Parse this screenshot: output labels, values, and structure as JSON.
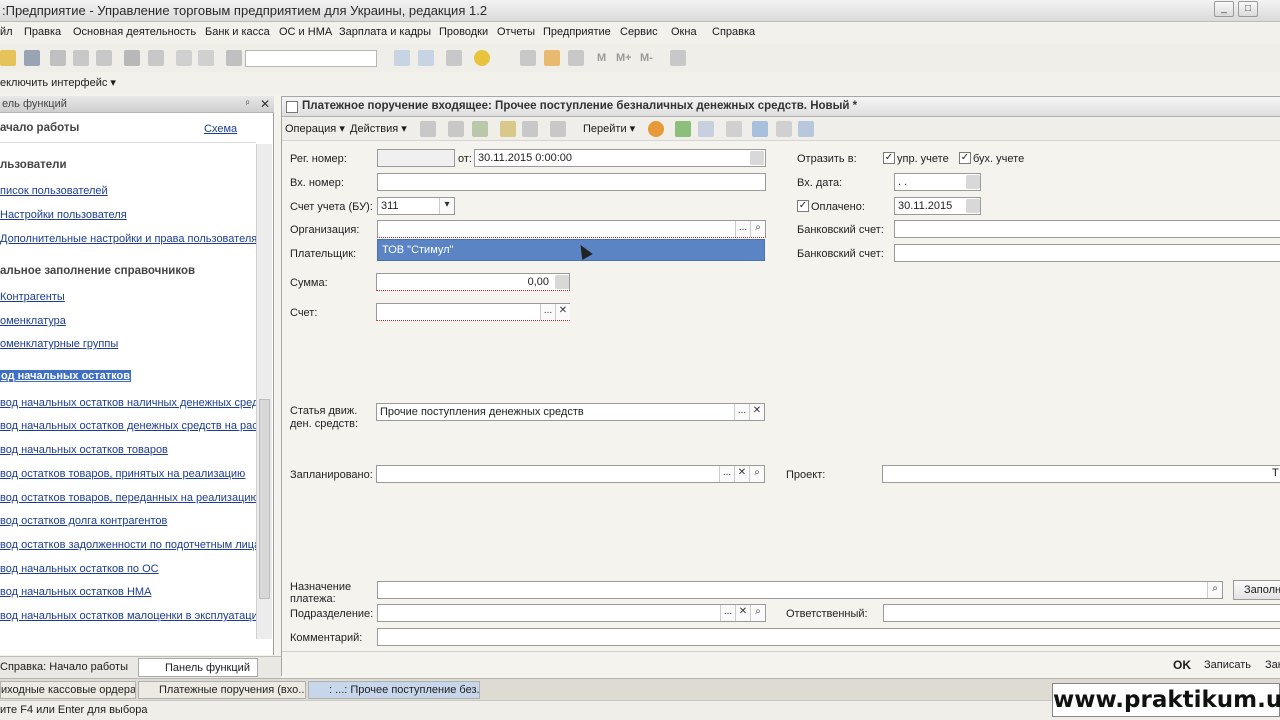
{
  "window": {
    "title": ":Предприятие - Управление торговым предприятием для Украины, редакция 1.2",
    "min": "_",
    "max": "□"
  },
  "menu": [
    "йл",
    "Правка",
    "Основная деятельность",
    "Банк и касса",
    "ОС и НМА",
    "Зарплата и кадры",
    "Проводки",
    "Отчеты",
    "Предприятие",
    "Сервис",
    "Окна",
    "Справка"
  ],
  "toolbar": {
    "m": "M",
    "mplus": "M+",
    "mminus": "M-"
  },
  "switch": {
    "label": "еключить интерфейс ▾"
  },
  "left_panel": {
    "header": "ель функций",
    "pin": "ᵖ",
    "close": "✕",
    "start": "ачало работы",
    "scheme": "Схема",
    "sec_users": "льзователи",
    "users": [
      "писок пользователей",
      "Настройки пользователя",
      "Дополнительные настройки и права пользователя"
    ],
    "sec_fill": "альное заполнение справочников",
    "fill": [
      "Контрагенты",
      "оменклатура",
      "оменклатурные группы"
    ],
    "sec_balances": "од начальных остатков",
    "balances": [
      "вод начальных остатков наличных денежных средс",
      "вод начальных остатков денежных средств на рас",
      "вод начальных остатков товаров",
      "вод остатков товаров, принятых на реализацию",
      "вод остатков товаров, переданных на реализацию",
      "вод остатков долга контрагентов",
      "вод остатков задолженности по подотчетным лица",
      "вод начальных остатков по ОС",
      "вод начальных остатков НМА",
      "вод начальных остатков малоценки в эксплуатаци"
    ]
  },
  "panel_tabs": {
    "help": "Справка: Начало работы",
    "functions": "Панель функций"
  },
  "form": {
    "title": "Платежное поручение входящее: Прочее поступление безналичных денежных средств. Новый *",
    "tb": {
      "operation": "Операция ▾",
      "actions": "Действия ▾",
      "goto": "Перейти ▾"
    },
    "reg_no_label": "Рег. номер:",
    "from_label": "от:",
    "date": "30.11.2015  0:00:00",
    "in_no_label": "Вх. номер:",
    "account_label": "Счет учета (БУ):",
    "account": "311",
    "org_label": "Организация:",
    "payer_label": "Плательщик:",
    "dropdown_item": "ТОВ \"Стимул\"",
    "sum_label": "Сумма:",
    "sum": "0,00",
    "schet_label": "Счет:",
    "reflect_label": "Отразить в:",
    "upr": "упр. учете",
    "buh": "бух. учете",
    "in_date_label": "Вх. дата:",
    "in_date": " .  .",
    "paid_label": "Оплачено:",
    "paid_date": "30.11.2015",
    "bank1_label": "Банковский счет:",
    "bank2_label": "Банковский счет:",
    "article_label1": "Статья движ.",
    "article_label2": "ден. средств:",
    "article": "Прочие поступления денежных средств",
    "planned_label": "Запланировано:",
    "project_label": "Проект:",
    "purpose_label1": "Назначение",
    "purpose_label2": "платежа:",
    "fill_btn": "Заполн",
    "dept_label": "Подразделение:",
    "resp_label": "Ответственный:",
    "comment_label": "Комментарий:",
    "ok": "OK",
    "save": "Записать",
    "close": "Зак",
    "check": "✓",
    "dots": "...",
    "x": "✕",
    "drop": "▾",
    "t": "T"
  },
  "taskbar": [
    "иходные кассовые ордера",
    "Платежные поручения (вхо...",
    ": ...: Прочее поступление без..."
  ],
  "status": "ите F4 или Enter для выбора",
  "watermark": "www.praktikum.ua"
}
